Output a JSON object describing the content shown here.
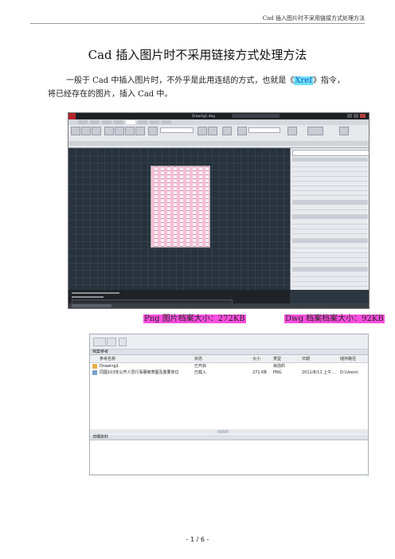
{
  "header": {
    "text": "Cad 插入图片时不采用链接方式处理方法"
  },
  "title": "Cad 插入图片时不采用链接方式处理方法",
  "paragraph": {
    "part1": "一般于 Cad 中插入图片时，不外乎是此用连结的方式，也就是《",
    "highlight": "Xref",
    "part2": "》指令，",
    "line2": "将已经存在的图片，插入 Cad 中。"
  },
  "cad_screenshot": {
    "filename_tab": "Drawing1.dwg",
    "panels": [
      "绘图",
      "修改",
      "图层",
      "注释",
      "块",
      "特性",
      "实用工具",
      "剪贴板"
    ],
    "properties": [
      "一般",
      "颜色",
      "图层",
      "线型",
      "线型比例",
      "线宽",
      "透明度",
      "厚度",
      "三维效果",
      "材质",
      "阴影显示",
      "打印样式",
      "视图",
      "圆心 X 坐标",
      "圆心 Y 坐标",
      "其他"
    ]
  },
  "caption": {
    "png": "Png 图片档案大小：272KB",
    "dwg": "Dwg 档案档案大小：92KB"
  },
  "xref_panel": {
    "section_refs": "档案参考",
    "columns": [
      "参考名称",
      "状态",
      "大小",
      "类型",
      "日期",
      "储存路径"
    ],
    "rows": [
      {
        "name": "Drawing1",
        "status": "已开启",
        "size": "",
        "type": "目前的",
        "date": "",
        "path": ""
      },
      {
        "name": "同图103年公开人员行事曆被表图及置要单位",
        "status": "已载入",
        "size": "271 KB",
        "type": "PNG",
        "date": "2011/8/11 上午...",
        "path": "D:\\Users\\"
      }
    ],
    "section_details": "详细资料"
  },
  "footer": "- 1 / 6 -"
}
